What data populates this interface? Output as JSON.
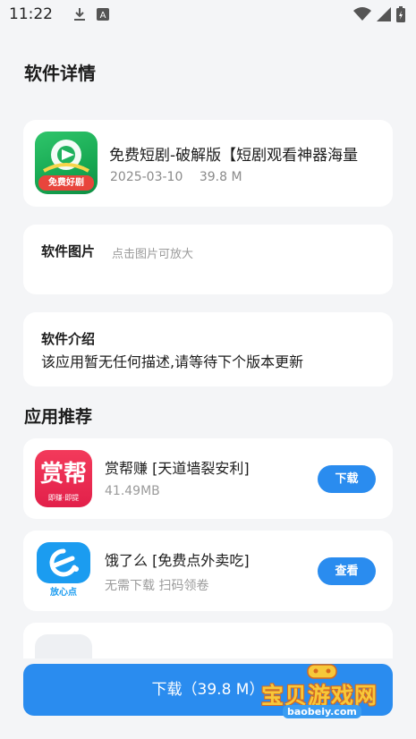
{
  "status_bar": {
    "time": "11:22",
    "icons": [
      "download-icon",
      "a-icon",
      "wifi-icon",
      "signal-icon",
      "battery-icon"
    ]
  },
  "page": {
    "title": "软件详情"
  },
  "app": {
    "icon_badge": "免费好剧",
    "name": "免费短剧-破解版【短剧观看神器海量",
    "date": "2025-03-10",
    "size": "39.8 M"
  },
  "pictures": {
    "label": "软件图片",
    "hint": "点击图片可放大"
  },
  "intro": {
    "label": "软件介绍",
    "text": "该应用暂无任何描述,请等待下个版本更新"
  },
  "recommend": {
    "title": "应用推荐",
    "items": [
      {
        "icon_text": "赏帮",
        "icon_sub": "即赚·即提",
        "name": "赏帮赚 [天道墙裂安利]",
        "sub": "41.49MB",
        "button": "下载"
      },
      {
        "icon_sub": "放心点",
        "name": "饿了么 [免费点外卖吃]",
        "sub": "无需下载 扫码领卷",
        "button": "查看"
      }
    ]
  },
  "download": {
    "label": "下载（39.8 M）"
  },
  "watermark": {
    "text": "宝贝游戏网",
    "url": "baobeiy.com"
  },
  "colors": {
    "accent": "#2a8cef",
    "background": "#f4f5f7"
  }
}
